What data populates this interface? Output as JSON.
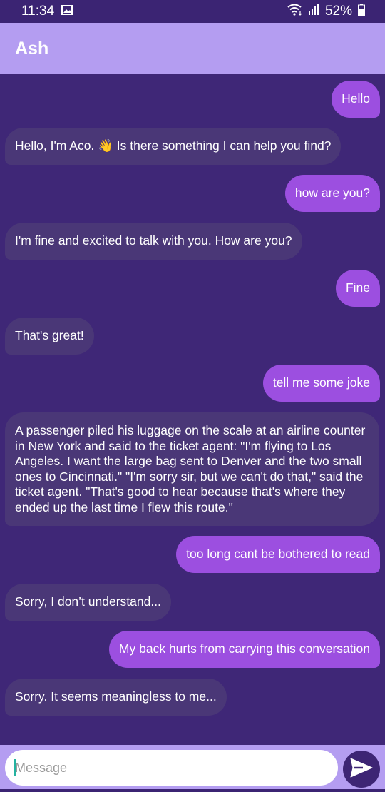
{
  "status_bar": {
    "time": "11:34",
    "battery": "52%",
    "icons": [
      "image-icon",
      "wifi-icon",
      "signal-icon",
      "battery-icon"
    ]
  },
  "header": {
    "title": "Ash"
  },
  "messages": [
    {
      "sender": "user",
      "text": "Hello"
    },
    {
      "sender": "bot",
      "text": "Hello, I'm Aco. 👋 Is there something I can help you find?"
    },
    {
      "sender": "user",
      "text": "how are you?"
    },
    {
      "sender": "bot",
      "text": "I'm fine and excited to talk with you. How are you?"
    },
    {
      "sender": "user",
      "text": "Fine"
    },
    {
      "sender": "bot",
      "text": "That's great!"
    },
    {
      "sender": "user",
      "text": "tell me some joke"
    },
    {
      "sender": "bot",
      "text": "A passenger piled his luggage on the scale at an airline counter in New York and said to the ticket agent: \"I'm flying to Los Angeles. I want the large bag sent to Denver and the two small ones to Cincinnati.\" \"I'm sorry sir, but we can't do that,\" said the ticket agent. \"That's good to hear because that's where they ended up the last time I flew this route.\""
    },
    {
      "sender": "user",
      "text": "too long cant be bothered to read"
    },
    {
      "sender": "bot",
      "text": "Sorry, I don’t understand..."
    },
    {
      "sender": "user",
      "text": "My back hurts from carrying this conversation"
    },
    {
      "sender": "bot",
      "text": "Sorry. It seems meaningless to me..."
    }
  ],
  "composer": {
    "placeholder": "Message",
    "value": "",
    "send_icon": "send-icon"
  },
  "colors": {
    "background": "#3f2777",
    "app_bar": "#b49df1",
    "user_bubble": "#9c4fe0",
    "bot_bubble": "#4a3777",
    "send_button": "#3d2574"
  }
}
